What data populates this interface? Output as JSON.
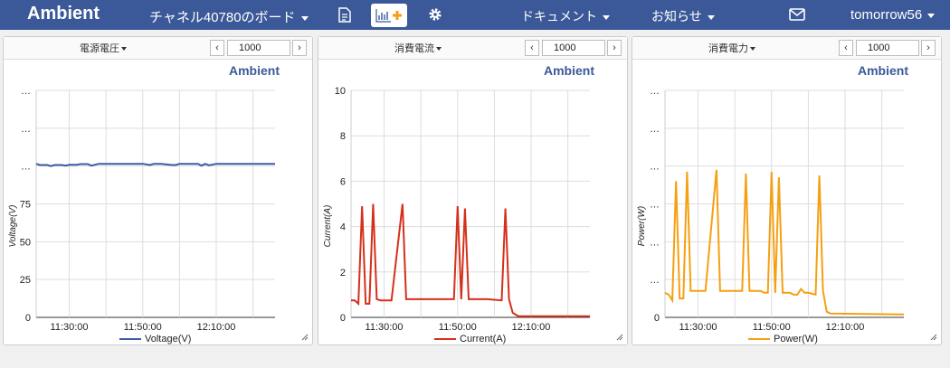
{
  "navbar": {
    "brand": "Ambient",
    "board_label": "チャネル40780のボード",
    "docs": "ドキュメント",
    "news": "お知らせ",
    "user": "tomorrow56",
    "icons": [
      "document-icon",
      "add-chart-icon",
      "gear-icon",
      "mail-icon"
    ]
  },
  "panels": [
    {
      "label": "電源電圧",
      "range": "1000",
      "watermark": "Ambient",
      "ylabel": "Voltage(V)",
      "legend": "Voltage(V)",
      "ytick_labels": [
        "…",
        "…",
        "…",
        "75",
        "50",
        "25",
        "0"
      ],
      "xtick_labels": [
        "11:30:00",
        "11:50:00",
        "12:10:00"
      ]
    },
    {
      "label": "消費電流",
      "range": "1000",
      "watermark": "Ambient",
      "ylabel": "Current(A)",
      "legend": "Current(A)",
      "ytick_labels": [
        "10",
        "8",
        "6",
        "4",
        "2",
        "0"
      ],
      "xtick_labels": [
        "11:30:00",
        "11:50:00",
        "12:10:00"
      ]
    },
    {
      "label": "消費電力",
      "range": "1000",
      "watermark": "Ambient",
      "ylabel": "Power(W)",
      "legend": "Power(W)",
      "ytick_labels": [
        "…",
        "…",
        "…",
        "…",
        "…",
        "…",
        "0"
      ],
      "xtick_labels": [
        "11:30:00",
        "11:50:00",
        "12:10:00"
      ]
    }
  ],
  "chart_data": [
    {
      "type": "line",
      "ylabel": "Voltage(V)",
      "color": "#3b5ba5",
      "x_time_range": [
        "11:21:00",
        "12:26:00"
      ],
      "xticks": [
        "11:30:00",
        "11:50:00",
        "12:10:00"
      ],
      "yticks": [
        0,
        25,
        50,
        75,
        100,
        125,
        150
      ],
      "ylim": [
        0,
        150
      ],
      "series": [
        {
          "name": "Voltage(V)",
          "x": [
            "11:21:00",
            "11:22:00",
            "11:24:00",
            "11:25:00",
            "11:26:00",
            "11:28:00",
            "11:29:00",
            "11:30:00",
            "11:32:00",
            "11:33:00",
            "11:35:00",
            "11:36:00",
            "11:38:00",
            "11:42:00",
            "11:50:00",
            "11:52:00",
            "11:53:00",
            "11:55:00",
            "11:58:00",
            "11:59:00",
            "12:00:00",
            "12:05:00",
            "12:06:00",
            "12:07:00",
            "12:08:00",
            "12:10:00",
            "12:26:00"
          ],
          "values": [
            101.5,
            100.7,
            100.7,
            100,
            100.7,
            100.7,
            100.3,
            100.8,
            100.8,
            101.3,
            101.3,
            100.3,
            101.5,
            101.5,
            101.5,
            100.7,
            101.4,
            101.4,
            100.7,
            100.7,
            101.5,
            101.5,
            100.3,
            101.5,
            100.5,
            101.5,
            101.5
          ]
        }
      ]
    },
    {
      "type": "line",
      "ylabel": "Current(A)",
      "color": "#d5301b",
      "x_time_range": [
        "11:21:00",
        "12:26:00"
      ],
      "xticks": [
        "11:30:00",
        "11:50:00",
        "12:10:00"
      ],
      "yticks": [
        0,
        2,
        4,
        6,
        8,
        10
      ],
      "ylim": [
        0,
        10
      ],
      "series": [
        {
          "name": "Current(A)",
          "x": [
            "11:21:00",
            "11:22:00",
            "11:23:00",
            "11:24:00",
            "11:25:00",
            "11:26:00",
            "11:27:00",
            "11:28:00",
            "11:29:00",
            "11:30:00",
            "11:32:00",
            "11:35:00",
            "11:36:00",
            "11:37:00",
            "11:38:00",
            "11:39:00",
            "11:40:00",
            "11:45:00",
            "11:49:00",
            "11:50:00",
            "11:51:00",
            "11:52:00",
            "11:53:00",
            "11:54:00",
            "11:55:00",
            "11:58:00",
            "12:02:00",
            "12:03:00",
            "12:04:00",
            "12:05:00",
            "12:06:00",
            "12:06:30",
            "12:07:00",
            "12:26:00"
          ],
          "values": [
            0.75,
            0.75,
            0.6,
            4.9,
            0.6,
            0.6,
            5.0,
            0.8,
            0.75,
            0.75,
            0.75,
            5.0,
            0.8,
            0.8,
            0.8,
            0.8,
            0.8,
            0.8,
            0.8,
            4.9,
            0.8,
            4.8,
            0.8,
            0.8,
            0.8,
            0.8,
            0.75,
            4.8,
            0.8,
            0.2,
            0.1,
            0.05,
            0.05,
            0.05
          ]
        }
      ]
    },
    {
      "type": "line",
      "ylabel": "Power(W)",
      "color": "#f5a011",
      "x_time_range": [
        "11:21:00",
        "12:26:00"
      ],
      "xticks": [
        "11:30:00",
        "11:50:00",
        "12:10:00"
      ],
      "yticks": [
        0,
        100,
        200,
        300,
        400,
        500,
        600
      ],
      "ylim": [
        0,
        600
      ],
      "series": [
        {
          "name": "Power(W)",
          "x": [
            "11:21:00",
            "11:22:00",
            "11:23:00",
            "11:24:00",
            "11:25:00",
            "11:26:00",
            "11:27:00",
            "11:28:00",
            "11:29:00",
            "11:30:00",
            "11:32:00",
            "11:35:00",
            "11:36:00",
            "11:39:00",
            "11:42:00",
            "11:43:00",
            "11:44:00",
            "11:47:00",
            "11:48:00",
            "11:49:00",
            "11:50:00",
            "11:51:00",
            "11:52:00",
            "11:53:00",
            "11:54:00",
            "11:55:00",
            "11:56:00",
            "11:57:00",
            "11:58:00",
            "11:59:00",
            "12:00:00",
            "12:02:00",
            "12:03:00",
            "12:04:00",
            "12:05:00",
            "12:06:00",
            "12:26:00"
          ],
          "values": [
            65,
            60,
            45,
            360,
            50,
            50,
            385,
            70,
            70,
            70,
            70,
            390,
            70,
            70,
            70,
            380,
            70,
            70,
            65,
            65,
            385,
            65,
            370,
            65,
            65,
            65,
            60,
            60,
            75,
            65,
            65,
            60,
            375,
            70,
            15,
            10,
            8
          ]
        }
      ]
    }
  ]
}
